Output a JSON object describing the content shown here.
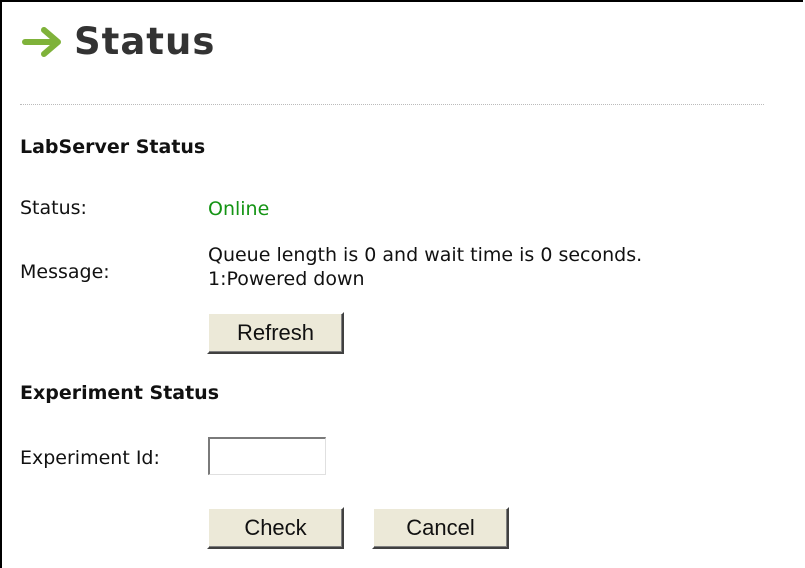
{
  "page": {
    "title": "Status"
  },
  "labserver": {
    "heading": "LabServer Status",
    "status_label": "Status:",
    "status_value": "Online",
    "message_label": "Message:",
    "message_line1": "Queue length is 0 and wait time is 0 seconds.",
    "message_line2": "1:Powered down",
    "refresh_label": "Refresh"
  },
  "experiment": {
    "heading": "Experiment Status",
    "id_label": "Experiment Id:",
    "id_value": "",
    "check_label": "Check",
    "cancel_label": "Cancel"
  },
  "colors": {
    "arrow": "#7fb23a",
    "online": "#149414"
  },
  "icons": {
    "title_icon": "right-arrow-icon"
  }
}
